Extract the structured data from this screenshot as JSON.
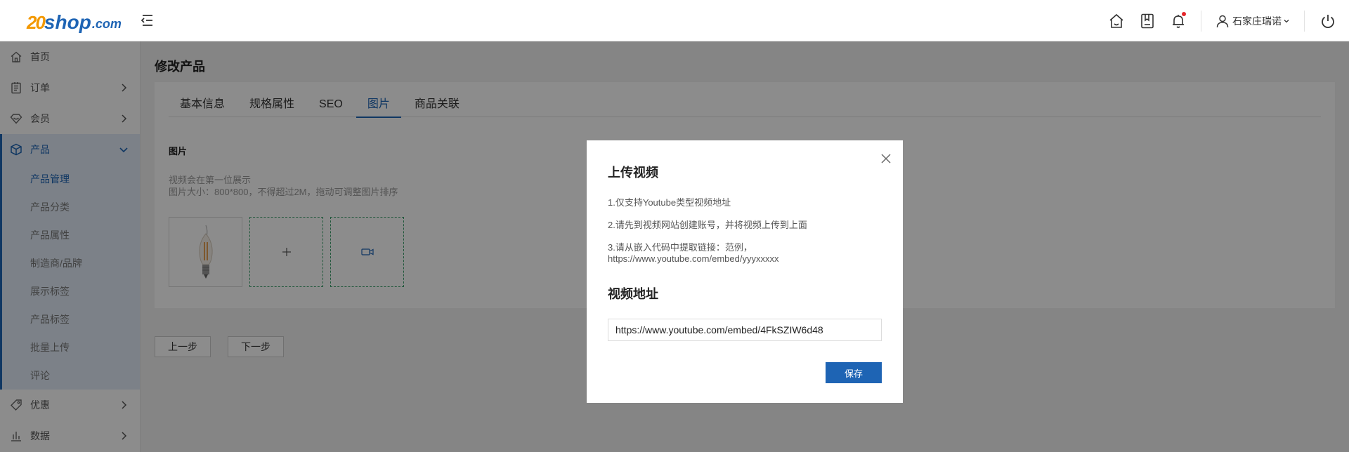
{
  "header": {
    "logo": {
      "num": "20",
      "shop": "shop",
      "com": ".com"
    },
    "user_name": "石家庄瑞诺",
    "icons": [
      "home-icon",
      "book-icon",
      "bell-icon",
      "user-icon",
      "power-icon"
    ],
    "notification_color": "#e5262b"
  },
  "sidebar": {
    "items": [
      {
        "label": "首页",
        "icon": "home-icon"
      },
      {
        "label": "订单",
        "icon": "order-icon"
      },
      {
        "label": "会员",
        "icon": "member-icon"
      },
      {
        "label": "产品",
        "icon": "product-icon"
      },
      {
        "label": "优惠",
        "icon": "tag-icon"
      },
      {
        "label": "数据",
        "icon": "chart-icon"
      }
    ],
    "sub_items": [
      "产品管理",
      "产品分类",
      "产品属性",
      "制造商/品牌",
      "展示标签",
      "产品标签",
      "批量上传",
      "评论"
    ]
  },
  "main": {
    "page_title": "修改产品",
    "tabs": [
      "基本信息",
      "规格属性",
      "SEO",
      "图片",
      "商品关联"
    ],
    "active_tab": "图片",
    "section_label": "图片",
    "tip_line1": "视频会在第一位展示",
    "tip_line2": "图片大小：800*800，不得超过2M，拖动可调整图片排序",
    "prev_button": "上一步",
    "next_button": "下一步"
  },
  "modal": {
    "title": "上传视频",
    "instruction1": "1.仅支持Youtube类型视频地址",
    "instruction2": "2.请先到视频网站创建账号，并将视频上传到上面",
    "instruction3_line1": "3.请从嵌入代码中提取链接：范例，",
    "instruction3_line2": "https://www.youtube.com/embed/yyyxxxxx",
    "url_heading": "视频地址",
    "url_value": "https://www.youtube.com/embed/4FkSZIW6d48",
    "save_button": "保存"
  },
  "colors": {
    "brand_blue": "#1e64b4",
    "brand_orange": "#f39800",
    "sidebar_active_bg": "#e2ecf7",
    "dashed_border": "#3a9e6a"
  }
}
